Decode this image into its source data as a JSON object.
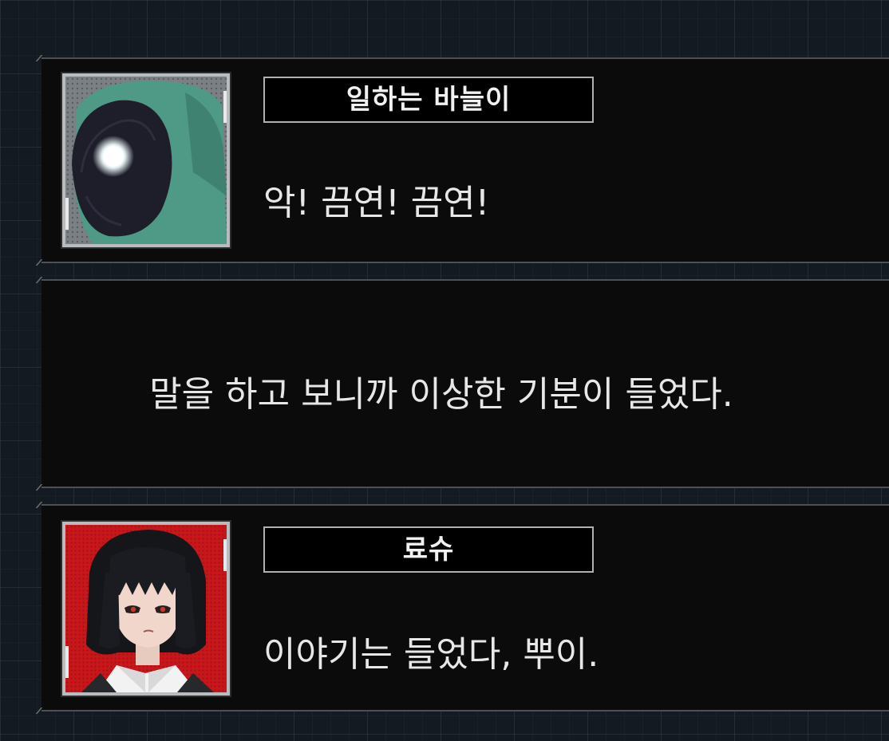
{
  "dialogs": [
    {
      "speaker": "일하는 바늘이",
      "line": "악! 끔연! 끔연!",
      "portrait": "hooded-green-figure-glowing-eye",
      "portrait_colors": {
        "hood": "#4e9a86",
        "face": "#1b1c27",
        "eye": "#ffffff",
        "bg": "#8a8f94"
      }
    },
    {
      "narration": "말을 하고 보니까 이상한 기분이 들었다."
    },
    {
      "speaker": "료슈",
      "line": "이야기는 들었다, 뿌이.",
      "portrait": "black-bob-haired-woman-red-background",
      "portrait_colors": {
        "hair": "#15161a",
        "skin": "#f1d7cb",
        "bg": "#c8171b",
        "eye": "#c23a2c"
      }
    }
  ]
}
